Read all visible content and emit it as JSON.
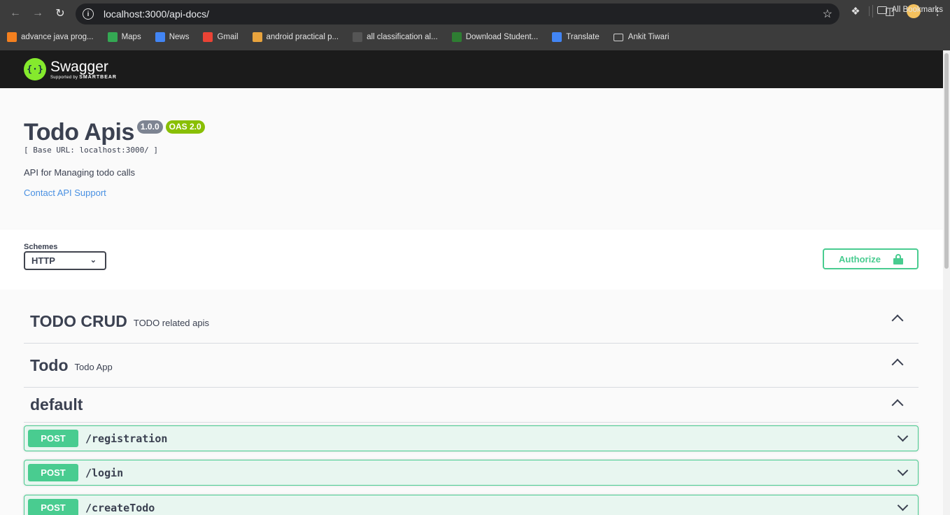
{
  "browser": {
    "url": "localhost:3000/api-docs/",
    "bookmarks": [
      {
        "label": "advance java prog...",
        "color": "#f4801f"
      },
      {
        "label": "Maps",
        "color": "#34a853"
      },
      {
        "label": "News",
        "color": "#4285f4"
      },
      {
        "label": "Gmail",
        "color": "#ea4335"
      },
      {
        "label": "android practical p...",
        "color": "#e8a33d"
      },
      {
        "label": "all classification al...",
        "color": "#555555"
      },
      {
        "label": "Download Student...",
        "color": "#2e7d32"
      },
      {
        "label": "Translate",
        "color": "#4285f4"
      },
      {
        "label": "Ankit Tiwari",
        "color": "folder"
      }
    ],
    "all_bookmarks": "All Bookmarks"
  },
  "swagger": {
    "brand": "Swagger",
    "supported_by": "Supported by",
    "smartbear": "SMARTBEAR"
  },
  "info": {
    "title": "Todo Apis",
    "version": "1.0.0",
    "oas": "OAS 2.0",
    "base_url": "[ Base URL: localhost:3000/ ]",
    "description": "API for Managing todo calls",
    "contact": "Contact API Support"
  },
  "schemes": {
    "label": "Schemes",
    "selected": "HTTP",
    "authorize": "Authorize"
  },
  "tags": [
    {
      "name": "TODO CRUD",
      "description": "TODO related apis"
    },
    {
      "name": "Todo",
      "description": "Todo App"
    },
    {
      "name": "default",
      "description": ""
    }
  ],
  "operations": [
    {
      "method": "POST",
      "path": "/registration"
    },
    {
      "method": "POST",
      "path": "/login"
    },
    {
      "method": "POST",
      "path": "/createTodo"
    }
  ]
}
